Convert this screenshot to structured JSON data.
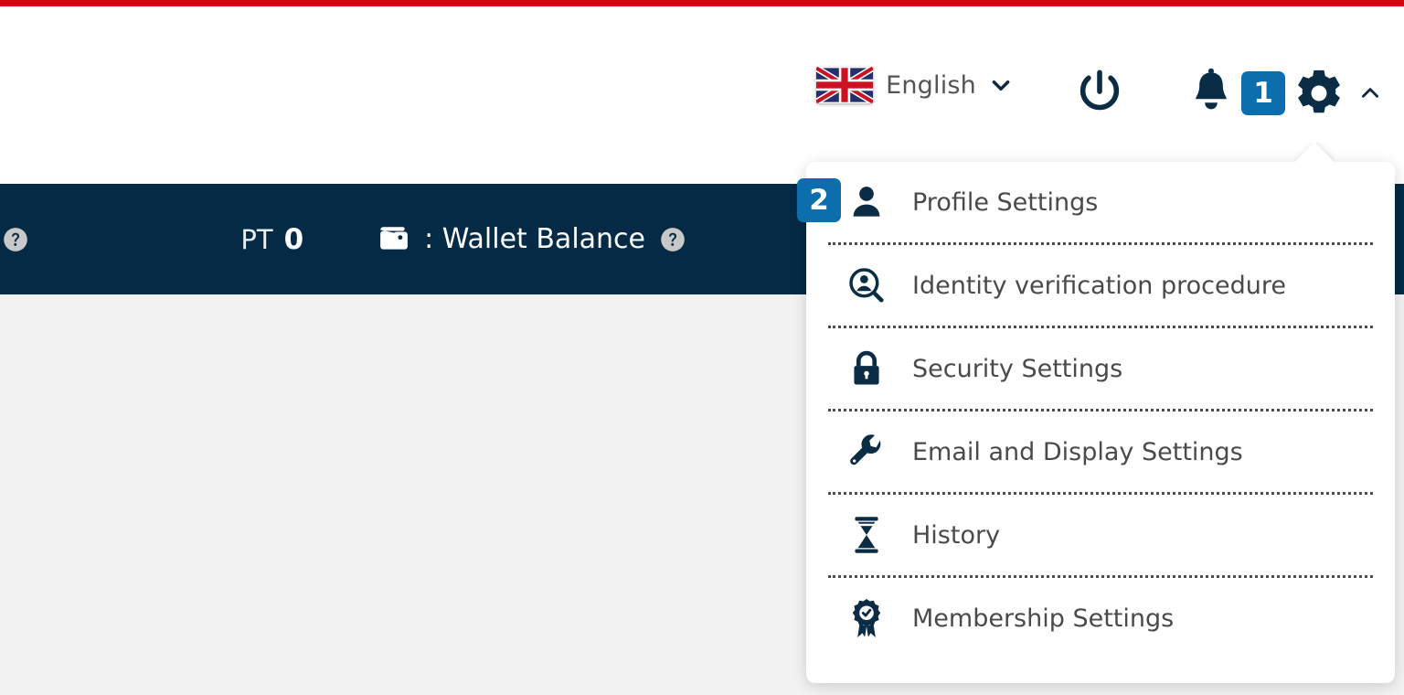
{
  "theme": {
    "accent_red": "#d9000f",
    "navy": "#042a45",
    "badge_blue": "#0d6ead",
    "body_bg": "#f2f2f2",
    "menu_text": "#4a4a4a"
  },
  "header": {
    "language": {
      "flag_icon": "uk-flag-icon",
      "label": "English",
      "chevron_icon": "chevron-down-icon"
    },
    "power_icon": "power-icon",
    "notifications": {
      "bell_icon": "bell-icon",
      "count": "1"
    },
    "settings": {
      "gear_icon": "gear-icon",
      "caret_icon": "chevron-up-icon"
    }
  },
  "navbar": {
    "help_icon_left": "help-circle-icon",
    "points": {
      "value": "0",
      "unit": "PT"
    },
    "wallet": {
      "icon": "wallet-icon",
      "label": "Wallet Balance :",
      "help_icon": "help-circle-icon"
    }
  },
  "dropdown": {
    "step_badge": "2",
    "items": [
      {
        "label": "Profile Settings",
        "icon": "user-icon"
      },
      {
        "label": "Identity verification procedure",
        "icon": "identity-search-icon"
      },
      {
        "label": "Security Settings",
        "icon": "lock-icon"
      },
      {
        "label": "Email and Display Settings",
        "icon": "wrench-icon"
      },
      {
        "label": "History",
        "icon": "hourglass-icon"
      },
      {
        "label": "Membership Settings",
        "icon": "award-ribbon-icon"
      }
    ]
  }
}
